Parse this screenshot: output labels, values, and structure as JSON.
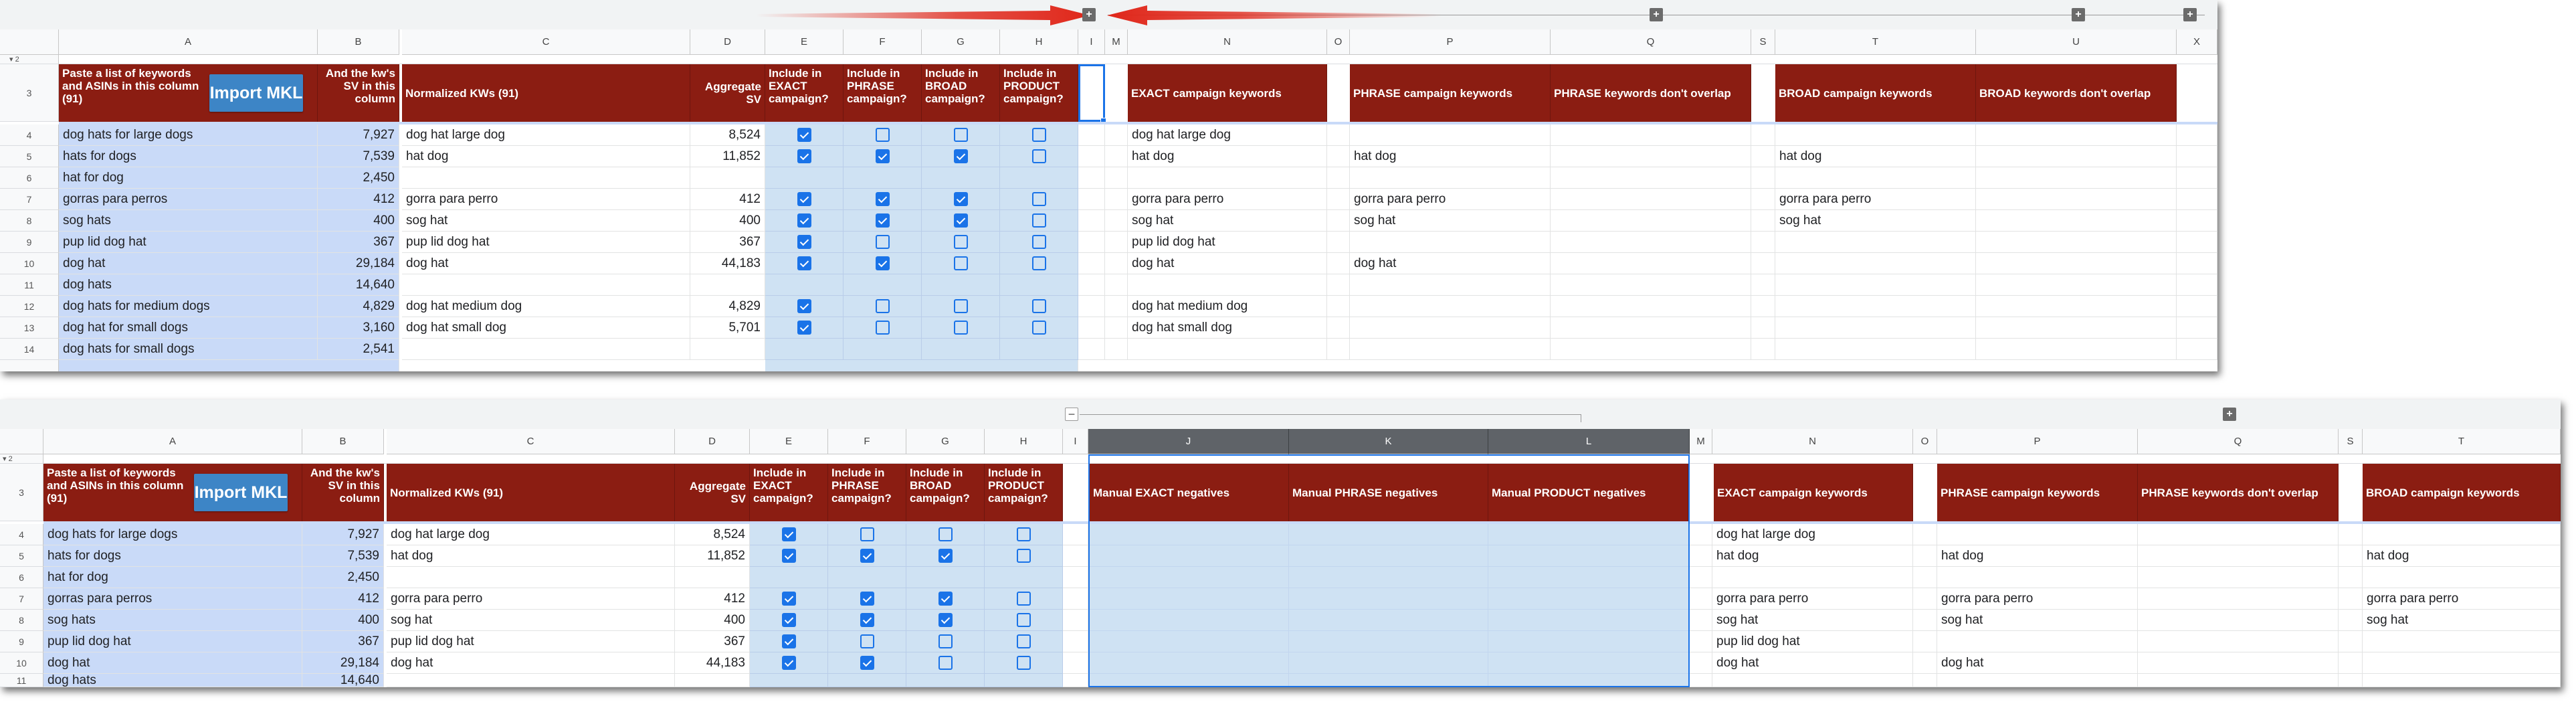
{
  "top_sheet": {
    "row2_label": "2",
    "columns": [
      "A",
      "B",
      "C",
      "D",
      "E",
      "F",
      "G",
      "H",
      "I",
      "M",
      "N",
      "O",
      "P",
      "Q",
      "S",
      "T",
      "U",
      "X"
    ],
    "headers": {
      "a": "Paste a list of keywords and ASINs in this column (91)",
      "b": "And the kw's SV in this column",
      "c": "Normalized KWs (91)",
      "d": "Aggregate SV",
      "e": "Include in EXACT campaign?",
      "f": "Include in PHRASE campaign?",
      "g": "Include in BROAD campaign?",
      "h": "Include in PRODUCT campaign?",
      "n": "EXACT campaign keywords",
      "p": "PHRASE campaign keywords",
      "q": "PHRASE keywords don't overlap",
      "t": "BROAD campaign keywords",
      "u": "BROAD keywords don't overlap"
    },
    "import_button": "Import MKL",
    "rows": [
      {
        "num": "4",
        "a": "dog hats for large dogs",
        "b": "7,927",
        "c": "dog hat large dog",
        "d": "8,524",
        "e": true,
        "f": false,
        "g": false,
        "h": false,
        "n": "dog hat large dog",
        "p": "",
        "t": ""
      },
      {
        "num": "5",
        "a": "hats for dogs",
        "b": "7,539",
        "c": "hat dog",
        "d": "11,852",
        "e": true,
        "f": true,
        "g": true,
        "h": false,
        "n": "hat dog",
        "p": "hat dog",
        "t": "hat dog"
      },
      {
        "num": "6",
        "a": "hat for dog",
        "b": "2,450",
        "c": "",
        "d": "",
        "e": null,
        "f": null,
        "g": null,
        "h": null,
        "n": "",
        "p": "",
        "t": ""
      },
      {
        "num": "7",
        "a": "gorras para perros",
        "b": "412",
        "c": "gorra para perro",
        "d": "412",
        "e": true,
        "f": true,
        "g": true,
        "h": false,
        "n": "gorra para perro",
        "p": "gorra para perro",
        "t": "gorra para perro"
      },
      {
        "num": "8",
        "a": "sog hats",
        "b": "400",
        "c": "sog hat",
        "d": "400",
        "e": true,
        "f": true,
        "g": true,
        "h": false,
        "n": "sog hat",
        "p": "sog hat",
        "t": "sog hat"
      },
      {
        "num": "9",
        "a": "pup lid dog hat",
        "b": "367",
        "c": "pup lid dog hat",
        "d": "367",
        "e": true,
        "f": false,
        "g": false,
        "h": false,
        "n": "pup lid dog hat",
        "p": "",
        "t": ""
      },
      {
        "num": "10",
        "a": "dog hat",
        "b": "29,184",
        "c": "dog hat",
        "d": "44,183",
        "e": true,
        "f": true,
        "g": false,
        "h": false,
        "n": "dog hat",
        "p": "dog hat",
        "t": ""
      },
      {
        "num": "11",
        "a": "dog hats",
        "b": "14,640",
        "c": "",
        "d": "",
        "e": null,
        "f": null,
        "g": null,
        "h": null,
        "n": "",
        "p": "",
        "t": ""
      },
      {
        "num": "12",
        "a": "dog hats for medium dogs",
        "b": "4,829",
        "c": "dog hat medium dog",
        "d": "4,829",
        "e": true,
        "f": false,
        "g": false,
        "h": false,
        "n": "dog hat medium dog",
        "p": "",
        "t": ""
      },
      {
        "num": "13",
        "a": "dog hat for small dogs",
        "b": "3,160",
        "c": "dog hat small dog",
        "d": "5,701",
        "e": true,
        "f": false,
        "g": false,
        "h": false,
        "n": "dog hat small dog",
        "p": "",
        "t": ""
      },
      {
        "num": "14",
        "a": "dog hats for small dogs",
        "b": "2,541",
        "c": "",
        "d": "",
        "e": null,
        "f": null,
        "g": null,
        "h": null,
        "n": "",
        "p": "",
        "t": ""
      }
    ]
  },
  "bottom_sheet": {
    "row2_label": "2",
    "columns": [
      "A",
      "B",
      "C",
      "D",
      "E",
      "F",
      "G",
      "H",
      "I",
      "J",
      "K",
      "L",
      "M",
      "N",
      "O",
      "P",
      "Q",
      "S",
      "T"
    ],
    "headers": {
      "a": "Paste a list of keywords and ASINs in this column (91)",
      "b": "And the kw's SV in this column",
      "c": "Normalized KWs (91)",
      "d": "Aggregate SV",
      "e": "Include in EXACT campaign?",
      "f": "Include in PHRASE campaign?",
      "g": "Include in BROAD campaign?",
      "h": "Include in PRODUCT campaign?",
      "j": "Manual EXACT negatives",
      "k": "Manual PHRASE negatives",
      "l": "Manual PRODUCT negatives",
      "n": "EXACT campaign keywords",
      "p": "PHRASE campaign keywords",
      "q": "PHRASE keywords don't overlap",
      "t": "BROAD campaign keywords"
    },
    "import_button": "Import MKL",
    "rows": [
      {
        "num": "4",
        "a": "dog hats for large dogs",
        "b": "7,927",
        "c": "dog hat large dog",
        "d": "8,524",
        "e": true,
        "f": false,
        "g": false,
        "h": false,
        "n": "dog hat large dog",
        "p": "",
        "t": ""
      },
      {
        "num": "5",
        "a": "hats for dogs",
        "b": "7,539",
        "c": "hat dog",
        "d": "11,852",
        "e": true,
        "f": true,
        "g": true,
        "h": false,
        "n": "hat dog",
        "p": "hat dog",
        "t": "hat dog"
      },
      {
        "num": "6",
        "a": "hat for dog",
        "b": "2,450",
        "c": "",
        "d": "",
        "e": null,
        "f": null,
        "g": null,
        "h": null,
        "n": "",
        "p": "",
        "t": ""
      },
      {
        "num": "7",
        "a": "gorras para perros",
        "b": "412",
        "c": "gorra para perro",
        "d": "412",
        "e": true,
        "f": true,
        "g": true,
        "h": false,
        "n": "gorra para perro",
        "p": "gorra para perro",
        "t": "gorra para perro"
      },
      {
        "num": "8",
        "a": "sog hats",
        "b": "400",
        "c": "sog hat",
        "d": "400",
        "e": true,
        "f": true,
        "g": true,
        "h": false,
        "n": "sog hat",
        "p": "sog hat",
        "t": "sog hat"
      },
      {
        "num": "9",
        "a": "pup lid dog hat",
        "b": "367",
        "c": "pup lid dog hat",
        "d": "367",
        "e": true,
        "f": false,
        "g": false,
        "h": false,
        "n": "pup lid dog hat",
        "p": "",
        "t": ""
      },
      {
        "num": "10",
        "a": "dog hat",
        "b": "29,184",
        "c": "dog hat",
        "d": "44,183",
        "e": true,
        "f": true,
        "g": false,
        "h": false,
        "n": "dog hat",
        "p": "dog hat",
        "t": ""
      },
      {
        "num": "11",
        "a": "dog hats",
        "b": "14,640",
        "c": "",
        "d": "",
        "e": null,
        "f": null,
        "g": null,
        "h": null,
        "n": "",
        "p": "",
        "t": ""
      }
    ]
  },
  "icons": {
    "expand": "plus-icon",
    "collapse": "minus-icon",
    "arrow": "arrow-icon"
  },
  "colors": {
    "header_red": "#8b1d12",
    "input_blue": "#c9daf8",
    "selection_blue": "#1a73e8",
    "arrow_red": "#e0271a"
  }
}
